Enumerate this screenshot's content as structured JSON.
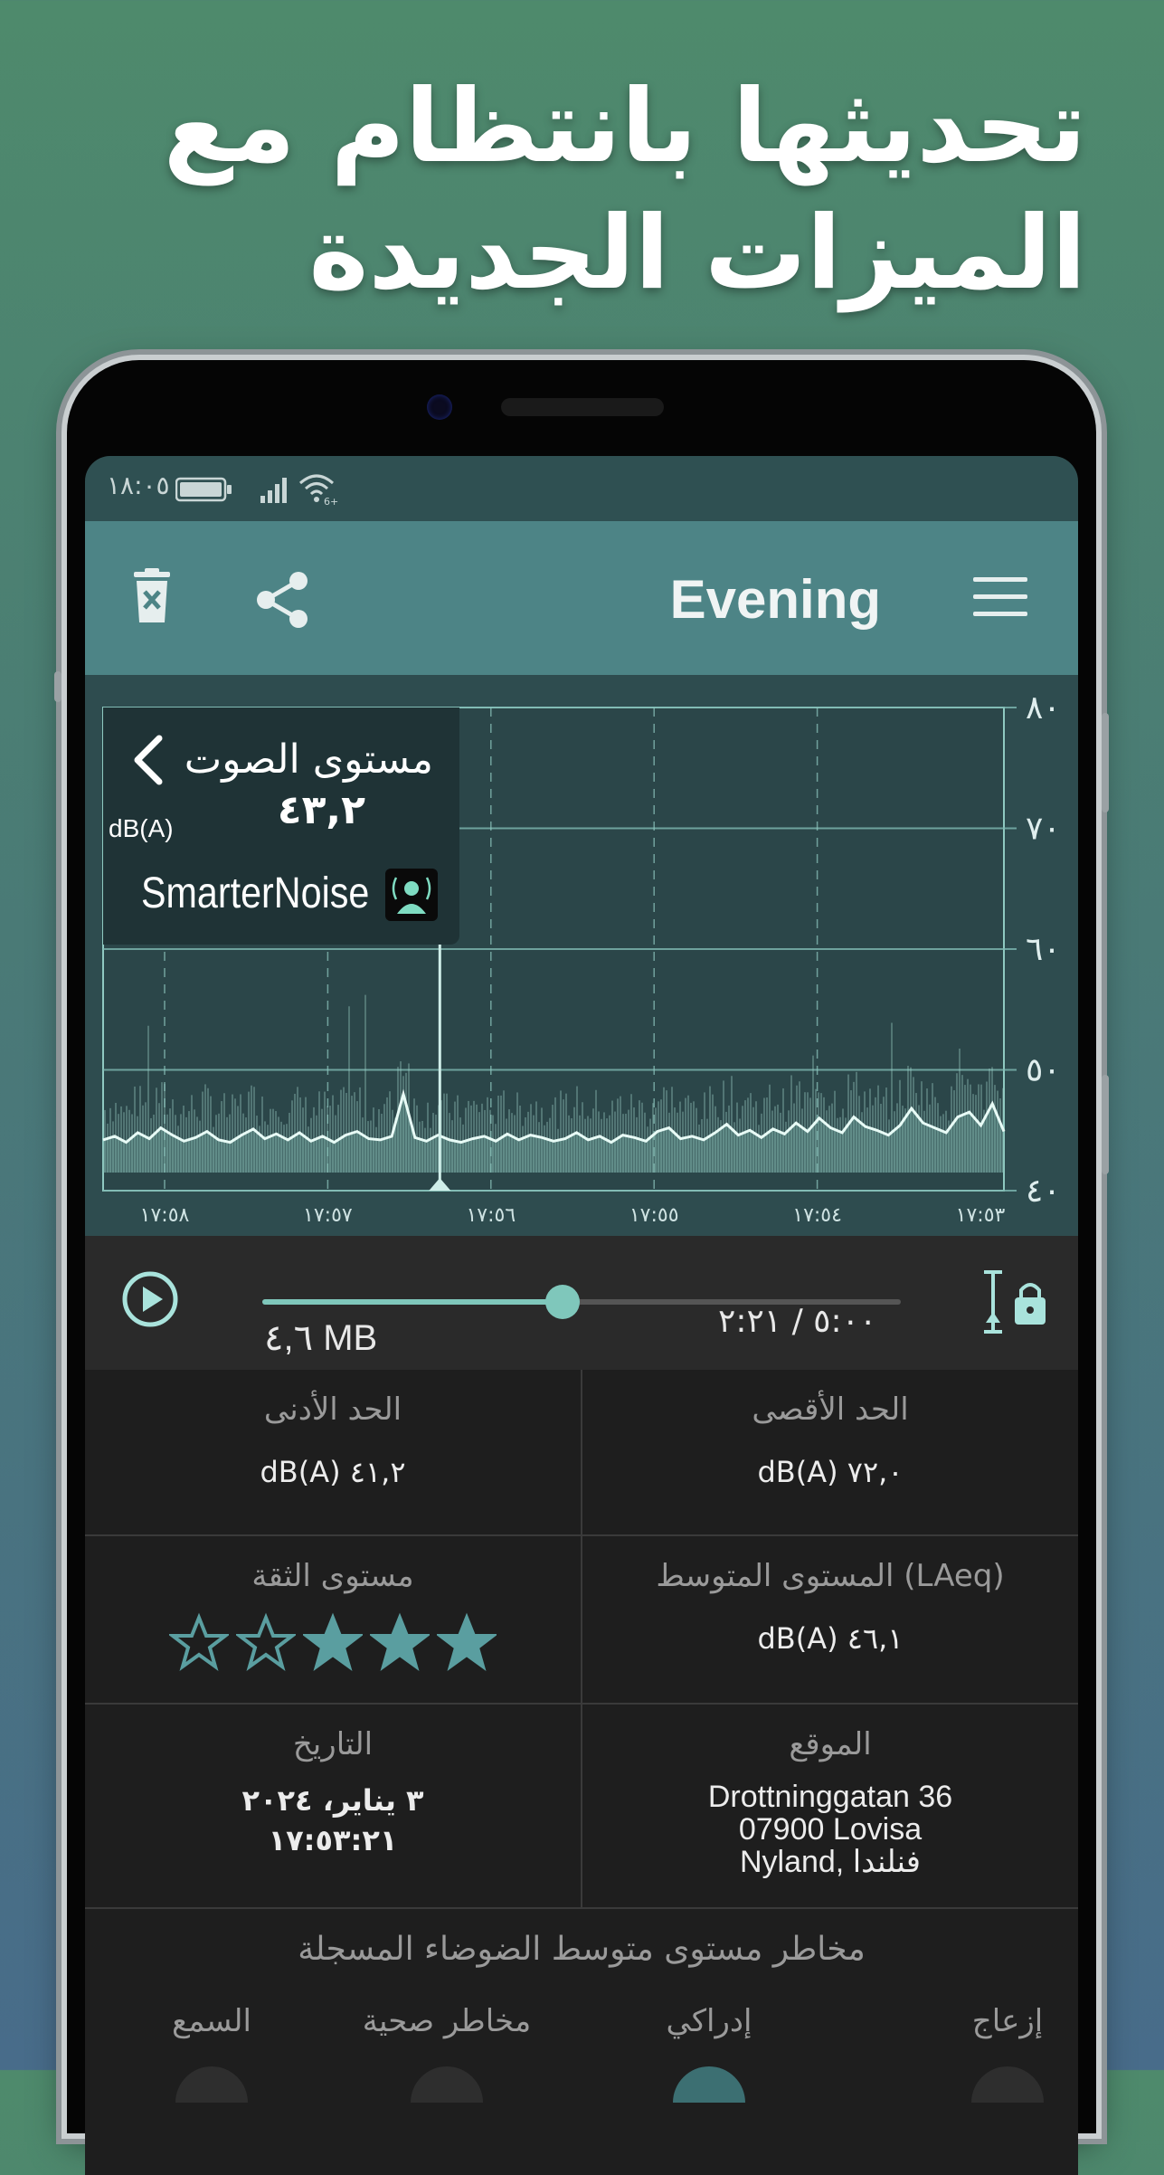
{
  "headline": {
    "line1": "تحديثها بانتظام مع",
    "line2": "الميزات الجديدة"
  },
  "status_bar": {
    "time": "١٨:٠٥"
  },
  "toolbar": {
    "title": "Evening",
    "icons": [
      "trash-icon",
      "share-icon",
      "menu-icon"
    ]
  },
  "chart": {
    "overlay_title": "مستوى الصوت",
    "overlay_value": "٤٣,٢",
    "overlay_unit": "dB(A)",
    "brand": "SmarterNoise"
  },
  "chart_data": {
    "type": "line",
    "y_ticks": [
      "٤٠",
      "٥٠",
      "٦٠",
      "٧٠",
      "٨٠"
    ],
    "ylim": [
      40,
      80
    ],
    "x_ticks": [
      "١٧:٥٨",
      "١٧:٥٧",
      "١٧:٥٦",
      "١٧:٥٥",
      "١٧:٥٤",
      "١٧:٥٣"
    ],
    "grid": true,
    "cursor_fraction": 0.534,
    "series": [
      {
        "values": [
          44.2,
          44.5,
          44.0,
          44.8,
          44.3,
          45.2,
          44.6,
          44.1,
          44.4,
          44.9,
          44.2,
          44.0,
          44.6,
          45.1,
          44.3,
          44.7,
          44.2,
          44.8,
          44.1,
          44.5,
          44.0,
          44.6,
          44.9,
          44.3,
          44.2,
          44.5,
          48.0,
          44.4,
          44.1,
          44.6,
          44.2,
          44.0,
          44.3,
          44.5,
          44.1,
          44.7,
          44.2,
          44.6,
          44.4,
          44.1,
          44.3,
          44.8,
          44.2,
          44.5,
          44.0,
          44.6,
          44.4,
          44.1,
          44.9,
          45.2,
          44.3,
          44.5,
          44.2,
          44.8,
          45.5,
          44.6,
          45.0,
          44.4,
          45.1,
          44.7,
          45.6,
          44.9,
          46.0,
          45.2,
          44.8,
          46.1,
          45.3,
          45.0,
          44.6,
          45.4,
          46.8,
          45.6,
          45.2,
          44.8,
          46.1,
          46.5,
          45.4,
          47.2,
          44.9
        ]
      }
    ]
  },
  "player": {
    "progress": 0.47,
    "size": "٤,٦ MB",
    "time": "٥:٠٠ / ٢:٢١"
  },
  "stats": {
    "max_label": "الحد الأقصى",
    "max_value": "dB(A) ٧٢,٠",
    "min_label": "الحد الأدنى",
    "min_value": "dB(A) ٤١,٢",
    "avg_label": "المستوى المتوسط (LAeq)",
    "avg_value": "dB(A) ٤٦,١",
    "confidence_label": "مستوى الثقة",
    "confidence_stars": 3,
    "confidence_total": 5,
    "location_label": "الموقع",
    "location_line1": "Drottninggatan 36",
    "location_line2": "07900 Lovisa",
    "location_line3": "Nyland, فنلندا",
    "date_label": "التاريخ",
    "date_line1": "٣ يناير، ٢٠٢٤",
    "date_line2": "١٧:٥٣:٢١"
  },
  "risks": {
    "title": "مخاطر مستوى متوسط الضوضاء المسجلة",
    "annoyance": "إزعاج",
    "cognitive": "إدراكي",
    "health": "مخاطر صحية",
    "hearing": "السمع"
  },
  "colors": {
    "accent": "#7fc7bb",
    "toolbar": "#4d8486",
    "chart_bg": "#2e4c4f"
  }
}
